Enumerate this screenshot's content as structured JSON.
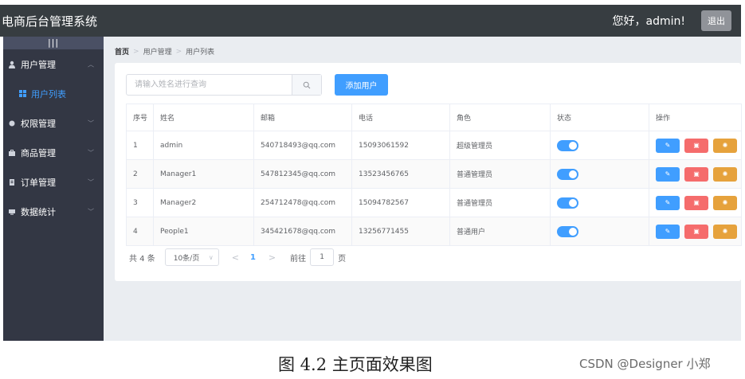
{
  "header": {
    "title": "电商后台管理系统",
    "greeting": "您好，admin!",
    "logout_label": "退出",
    "background": "#373d41"
  },
  "sidebar": {
    "toggle_label": "|||",
    "background": "#333744",
    "active_color": "#409eff",
    "menus": [
      {
        "label": "用户管理",
        "icon": "user-icon",
        "expanded": true,
        "children": [
          {
            "label": "用户列表",
            "icon": "grid-icon",
            "active": true
          }
        ]
      },
      {
        "label": "权限管理",
        "icon": "shield-icon"
      },
      {
        "label": "商品管理",
        "icon": "briefcase-icon"
      },
      {
        "label": "订单管理",
        "icon": "order-icon"
      },
      {
        "label": "数据统计",
        "icon": "chart-icon"
      }
    ]
  },
  "breadcrumb": [
    "首页",
    "用户管理",
    "用户列表"
  ],
  "search": {
    "placeholder": "请输入姓名进行查询",
    "value": ""
  },
  "add_button_label": "添加用户",
  "table": {
    "columns": [
      "序号",
      "姓名",
      "邮箱",
      "电话",
      "角色",
      "状态",
      "操作"
    ],
    "rows": [
      {
        "index": "1",
        "name": "admin",
        "email": "540718493@qq.com",
        "phone": "15093061592",
        "role": "超级管理员",
        "status": true
      },
      {
        "index": "2",
        "name": "Manager1",
        "email": "547812345@qq.com",
        "phone": "13523456765",
        "role": "普通管理员",
        "status": true
      },
      {
        "index": "3",
        "name": "Manager2",
        "email": "254712478@qq.com",
        "phone": "15094782567",
        "role": "普通管理员",
        "status": true
      },
      {
        "index": "4",
        "name": "People1",
        "email": "345421678@qq.com",
        "phone": "13256771455",
        "role": "普通用户",
        "status": true
      }
    ]
  },
  "pagination": {
    "total_label": "共 4 条",
    "page_size_label": "10条/页",
    "current_page": "1",
    "goto_prefix": "前往",
    "goto_value": "1",
    "goto_suffix": "页"
  },
  "caption": "图 4.2 主页面效果图",
  "watermark": "CSDN @Designer 小郑"
}
